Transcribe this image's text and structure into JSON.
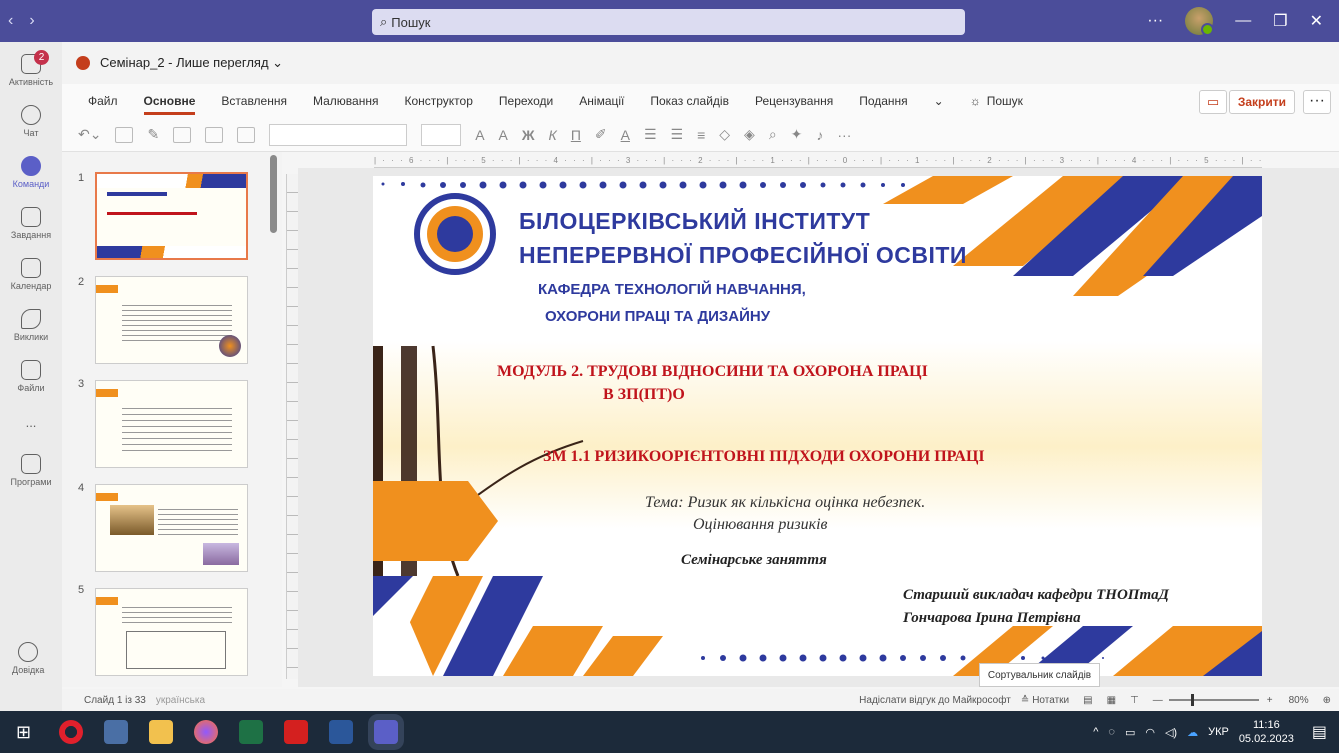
{
  "window": {
    "search_placeholder": "Пошук",
    "nav_back": "‹",
    "nav_fwd": "›",
    "more": "···"
  },
  "rail": [
    {
      "label": "Активність",
      "badge": "2"
    },
    {
      "label": "Чат"
    },
    {
      "label": "Команди",
      "active": true
    },
    {
      "label": "Завдання"
    },
    {
      "label": "Календар"
    },
    {
      "label": "Виклики"
    },
    {
      "label": "Файли"
    },
    {
      "label": "..."
    },
    {
      "label": "Програми"
    },
    {
      "label": "Довідка"
    }
  ],
  "doc": {
    "title": "Семінар_2 - Лише перегляд ⌄"
  },
  "ribbon": {
    "tabs": [
      "Файл",
      "Основне",
      "Вставлення",
      "Малювання",
      "Конструктор",
      "Переходи",
      "Анімації",
      "Показ слайдів",
      "Рецензування",
      "Подання",
      "⌄",
      "Пошук"
    ],
    "close": "Закрити",
    "more": "···"
  },
  "ruler": "| · · · 6 · · · | · · · 5 · · · | · · · 4 · · · | · · · 3 · · · | · · · 2 · · · | · · · 1 · · · | · · · 0 · · · | · · · 1 · · · | · · · 2 · · · | · · · 3 · · · | · · · 4 · · · | · · · 5 · · · | · · · 6 · · · |",
  "thumbnails": [
    "1",
    "2",
    "3",
    "4",
    "5"
  ],
  "slide": {
    "inst1": "БІЛОЦЕРКІВСЬКИЙ ІНСТИТУТ",
    "inst2": "НЕПЕРЕРВНОЇ ПРОФЕСІЙНОЇ ОСВІТИ",
    "dept1": "КАФЕДРА ТЕХНОЛОГІЙ НАВЧАННЯ,",
    "dept2": "ОХОРОНИ ПРАЦІ ТА ДИЗАЙНУ",
    "module1": "МОДУЛЬ 2. ТРУДОВІ ВІДНОСИНИ ТА ОХОРОНА ПРАЦІ",
    "module2": "В ЗП(ПТ)О",
    "zm": "ЗМ 1.1  РИЗИКООРІЄНТОВНІ ПІДХОДИ ОХОРОНИ ПРАЦІ",
    "topic1": "Тема: Ризик як кількісна оцінка небезпек.",
    "topic2": "Оцінювання ризиків",
    "seminar": "Семінарське заняття",
    "author1": "Старший викладач кафедри ТНОПтаД",
    "author2": "Гончарова Ірина Петрівна",
    "colors": {
      "blue": "#2e3a9e",
      "orange": "#f0901e",
      "red": "#c0141c"
    }
  },
  "status": {
    "slide": "Слайд 1 із 33",
    "lang": "українська",
    "feedback": "Надіслати відгук до Майкрософт",
    "notes": "Нотатки",
    "zoom": "80%",
    "tooltip": "Сортувальник слайдів"
  },
  "taskbar": {
    "lang": "УКР",
    "time": "11:16",
    "date": "05.02.2023"
  }
}
